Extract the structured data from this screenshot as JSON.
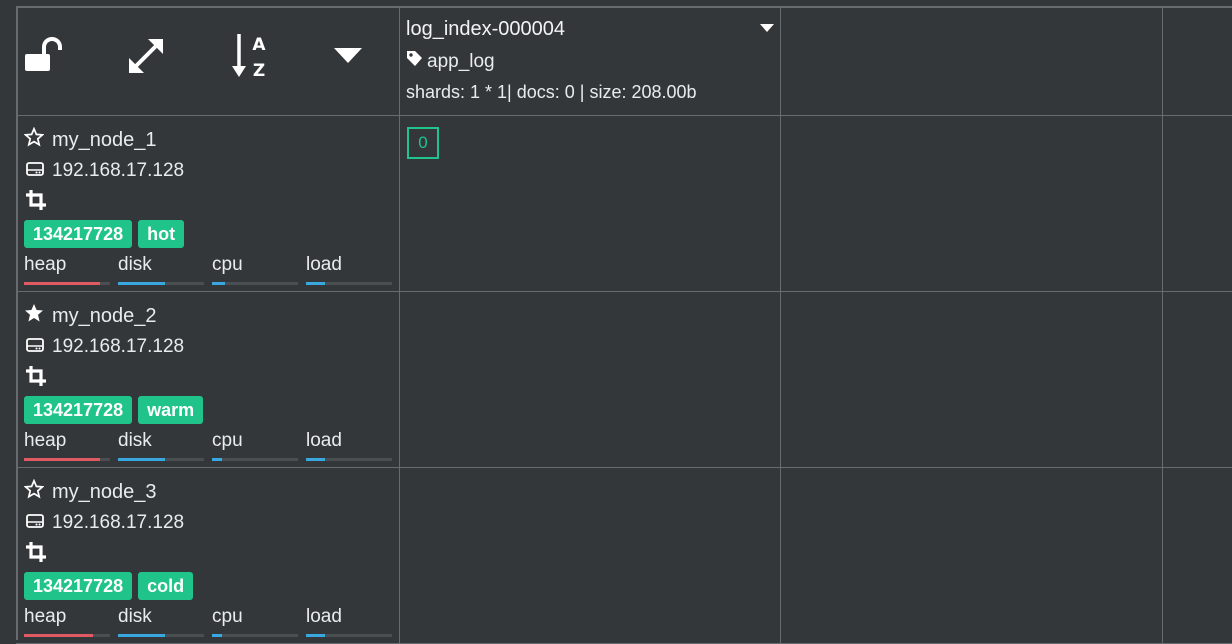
{
  "header": {
    "controls": [
      {
        "name": "unlock-icon"
      },
      {
        "name": "expand-icon"
      },
      {
        "name": "sort-alpha-icon",
        "text_a": "A",
        "text_z": "Z"
      },
      {
        "name": "caret-down-icon"
      }
    ]
  },
  "index": {
    "name": "log_index-000004",
    "alias": "app_log",
    "stats": "shards: 1 * 1| docs: 0 | size: 208.00b",
    "shard_label": "0"
  },
  "colors": {
    "accent": "#20c38a",
    "heap": "#e05a64",
    "disk": "#3aa8e0",
    "cpu": "#3aa8e0",
    "load": "#3aa8e0"
  },
  "metric_labels": [
    "heap",
    "disk",
    "cpu",
    "load"
  ],
  "nodes": [
    {
      "name": "my_node_1",
      "master": false,
      "ip": "192.168.17.128",
      "badges": [
        "134217728",
        "hot"
      ],
      "metrics": {
        "heap": 0.88,
        "disk": 0.55,
        "cpu": 0.15,
        "load": 0.22
      }
    },
    {
      "name": "my_node_2",
      "master": true,
      "ip": "192.168.17.128",
      "badges": [
        "134217728",
        "warm"
      ],
      "metrics": {
        "heap": 0.88,
        "disk": 0.55,
        "cpu": 0.12,
        "load": 0.22
      }
    },
    {
      "name": "my_node_3",
      "master": false,
      "ip": "192.168.17.128",
      "badges": [
        "134217728",
        "cold"
      ],
      "metrics": {
        "heap": 0.8,
        "disk": 0.55,
        "cpu": 0.12,
        "load": 0.22
      }
    }
  ]
}
